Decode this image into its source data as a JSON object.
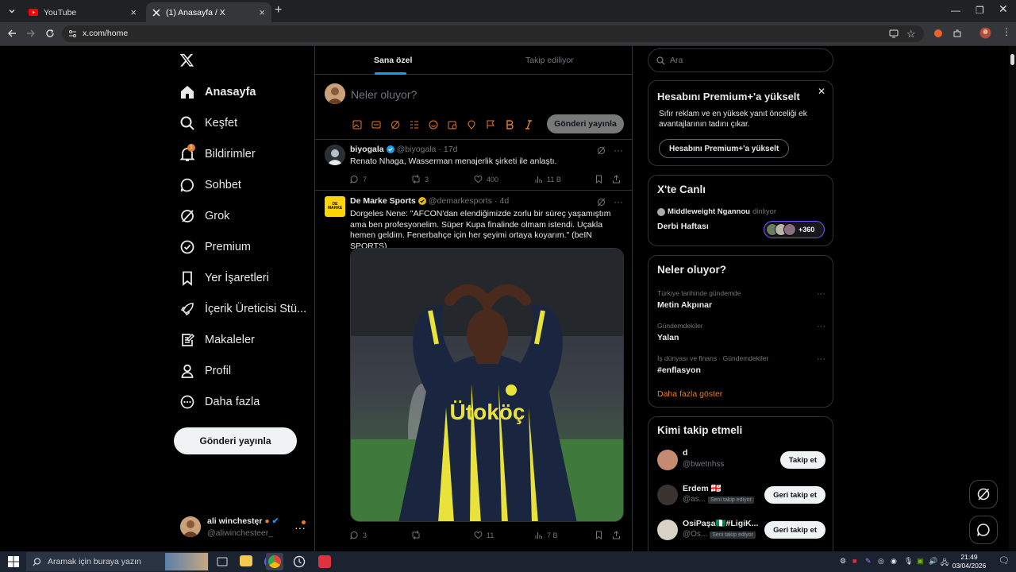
{
  "browser": {
    "tabs": [
      {
        "title": "YouTube",
        "active": false
      },
      {
        "title": "(1) Anasayfa / X",
        "active": true
      }
    ],
    "url": "x.com/home"
  },
  "nav": {
    "items": [
      {
        "label": "Anasayfa",
        "icon": "home-icon",
        "active": true
      },
      {
        "label": "Keşfet",
        "icon": "search-icon"
      },
      {
        "label": "Bildirimler",
        "icon": "bell-icon",
        "badge": "1"
      },
      {
        "label": "Sohbet",
        "icon": "chat-icon"
      },
      {
        "label": "Grok",
        "icon": "grok-icon"
      },
      {
        "label": "Premium",
        "icon": "premium-icon"
      },
      {
        "label": "Yer İşaretleri",
        "icon": "bookmark-icon"
      },
      {
        "label": "İçerik Üreticisi Stü...",
        "icon": "rocket-icon"
      },
      {
        "label": "Makaleler",
        "icon": "article-icon"
      },
      {
        "label": "Profil",
        "icon": "profile-icon"
      },
      {
        "label": "Daha fazla",
        "icon": "more-circle-icon"
      }
    ],
    "post_button": "Gönderi yayınla",
    "account": {
      "name": "ali winchestęr",
      "handle": "@aliwinchesteer_"
    }
  },
  "feed": {
    "tabs": [
      "Sana özel",
      "Takip ediliyor"
    ],
    "composer": {
      "placeholder": "Neler oluyor?",
      "post_button": "Gönderi yayınla"
    },
    "tweets": [
      {
        "name": "biyogala",
        "handle": "@biyogala",
        "time": "17d",
        "text": "Renato Nhaga, Wasserman menajerlik şirketi ile anlaştı.",
        "replies": "7",
        "reposts": "3",
        "likes": "400",
        "views": "11 B"
      },
      {
        "name": "De Marke Sports",
        "handle": "@demarkesports",
        "time": "4d",
        "avatar_text": "DE MARKE",
        "text": "Dorgeles Nene: \"AFCON'dan elendiğimizde zorlu bir süreç yaşamıştım ama ben profesyonelim. Süper Kupa finalinde olmam istendi. Uçakla hemen geldim. Fenerbahçe için her şeyimi ortaya koyarım.\" (beIN SPORTS)",
        "jersey_text": "Ütoköç",
        "replies": "3",
        "reposts": "",
        "likes": "11",
        "views": "7 B"
      }
    ]
  },
  "sidebar": {
    "search_placeholder": "Ara",
    "premium": {
      "title": "Hesabını Premium+'a yükselt",
      "desc": "Sıfır reklam ve en yüksek yanıt önceliği ek avantajlarının tadını çıkar.",
      "button": "Hesabını Premium+'a yükselt"
    },
    "live": {
      "title": "X'te Canlı",
      "host": "Middleweight Ngannou",
      "host_status": "dinliyor",
      "space_title": "Derbi Haftası",
      "listeners": "+360"
    },
    "trends": {
      "title": "Neler oluyor?",
      "items": [
        {
          "context": "Türkiye tarihinde gündemde",
          "name": "Metin Akpınar"
        },
        {
          "context": "Gündemdekiler",
          "name": "Yalan"
        },
        {
          "context": "İş dünyası ve finans · Gündemdekiler",
          "name": "#enflasyon"
        }
      ],
      "show_more": "Daha fazla göster"
    },
    "who_to_follow": {
      "title": "Kimi takip etmeli",
      "items": [
        {
          "name": "d",
          "handle": "@bwetnhss",
          "badge": "",
          "button": "Takip et"
        },
        {
          "name": "Erdem 🇬🇪",
          "handle": "@as...",
          "badge": "Seni takip ediyor",
          "button": "Geri takip et"
        },
        {
          "name": "OsiPaşa🇳🇬#LigiK...",
          "handle": "@Os...",
          "badge": "Seni takip ediyor",
          "button": "Geri takip et"
        }
      ]
    }
  },
  "taskbar": {
    "search_placeholder": "Aramak için buraya yazın",
    "time": "21:49",
    "date": "03/04/2026"
  },
  "colors": {
    "accent": "#1d9bf0",
    "brand_orange": "#e57d2d",
    "background": "#000000",
    "border": "#2f3336"
  }
}
